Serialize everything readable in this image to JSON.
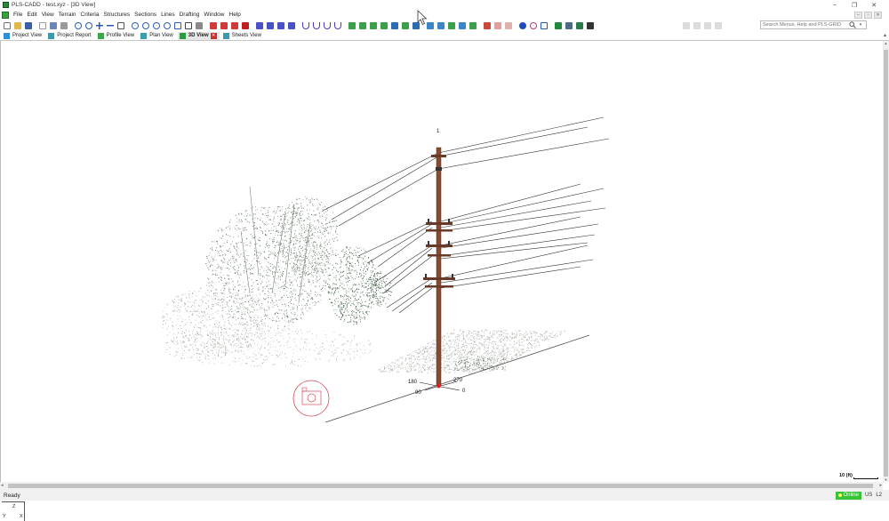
{
  "window": {
    "title": "PLS-CADD - test.xyz - [3D View]",
    "controls": [
      "–",
      "❐",
      "✕"
    ]
  },
  "menu": {
    "items": [
      "File",
      "Edit",
      "View",
      "Terrain",
      "Criteria",
      "Structures",
      "Sections",
      "Lines",
      "Drafting",
      "Window",
      "Help"
    ],
    "mdi_controls": [
      "–",
      "▫",
      "✕"
    ]
  },
  "toolbar": {
    "search_placeholder": "Search Menus, Help and PLS-GRID"
  },
  "tabs": [
    {
      "label": "Project View",
      "active": false,
      "color": "#2d8fd6"
    },
    {
      "label": "Project Report",
      "active": false,
      "color": "#3a9aa8"
    },
    {
      "label": "Profile View",
      "active": false,
      "color": "#3da64a"
    },
    {
      "label": "Plan View",
      "active": false,
      "color": "#3aa0b0"
    },
    {
      "label": "3D View",
      "active": true,
      "color": "#2e9a3e"
    },
    {
      "label": "Sheets View",
      "active": false,
      "color": "#3a9ab0"
    }
  ],
  "viewport": {
    "structure_number": "1",
    "compass": {
      "north": "180",
      "east": "270",
      "south": "90",
      "west": "0"
    },
    "scale_label": "10 (ft)",
    "axes": {
      "z": "Z",
      "y": "Y",
      "x": "X"
    }
  },
  "status": {
    "text": "Ready",
    "online": "Online",
    "units": "US",
    "level": "L2"
  }
}
